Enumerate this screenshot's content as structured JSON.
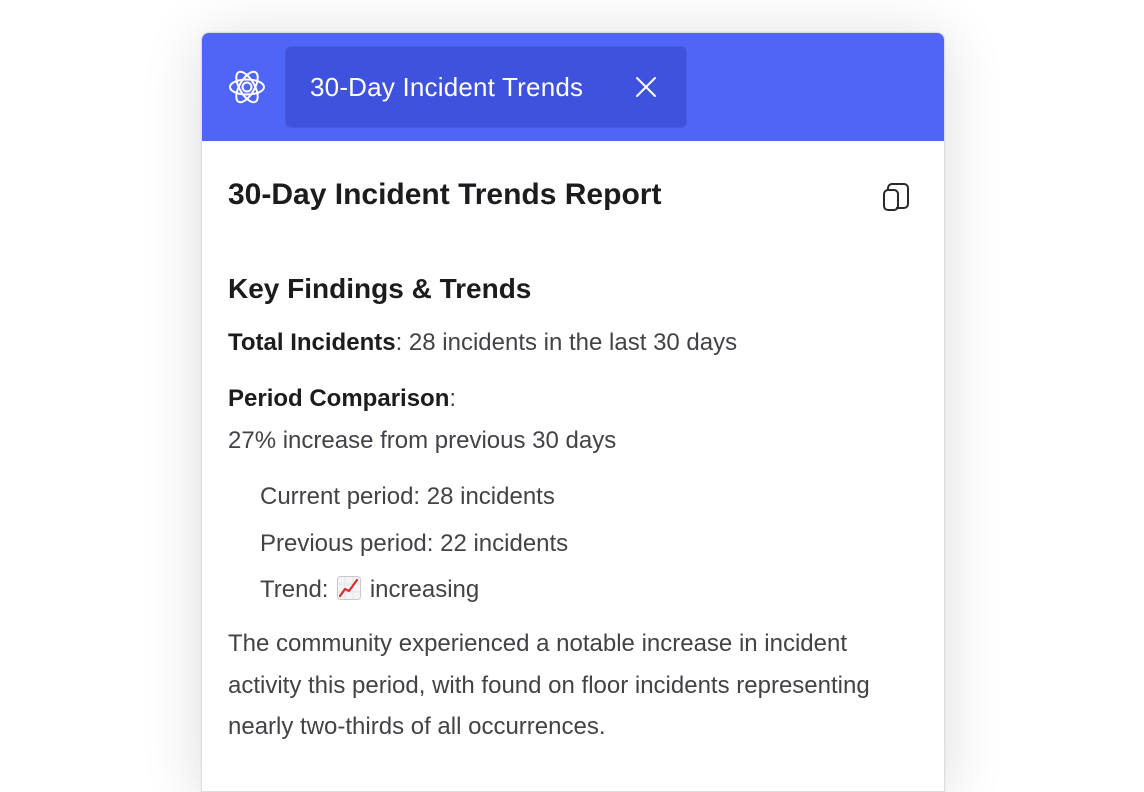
{
  "header": {
    "brand_color": "#4f65f5",
    "tab_color": "#3f52de",
    "logo_icon": "openai-logo-icon",
    "tab": {
      "label": "30-Day Incident Trends",
      "close_icon": "close-icon"
    }
  },
  "report": {
    "title": "30-Day Incident Trends Report",
    "copy_icon": "copy-icon",
    "section_heading": "Key Findings & Trends",
    "total_label": "Total Incidents",
    "total_value": ": 28 incidents in the last 30 days",
    "comparison_label": "Period Comparison",
    "comparison_colon": ":",
    "comparison_value": "27% increase from previous 30 days",
    "details": {
      "current": "Current period: 28 incidents",
      "previous": "Previous period: 22 incidents",
      "trend_prefix": "Trend:",
      "trend_icon": "chart-increasing-icon",
      "trend_value": "increasing"
    },
    "summary": "The community experienced a notable increase in incident activity this period, with found on floor incidents representing nearly two-thirds of all occurrences."
  }
}
